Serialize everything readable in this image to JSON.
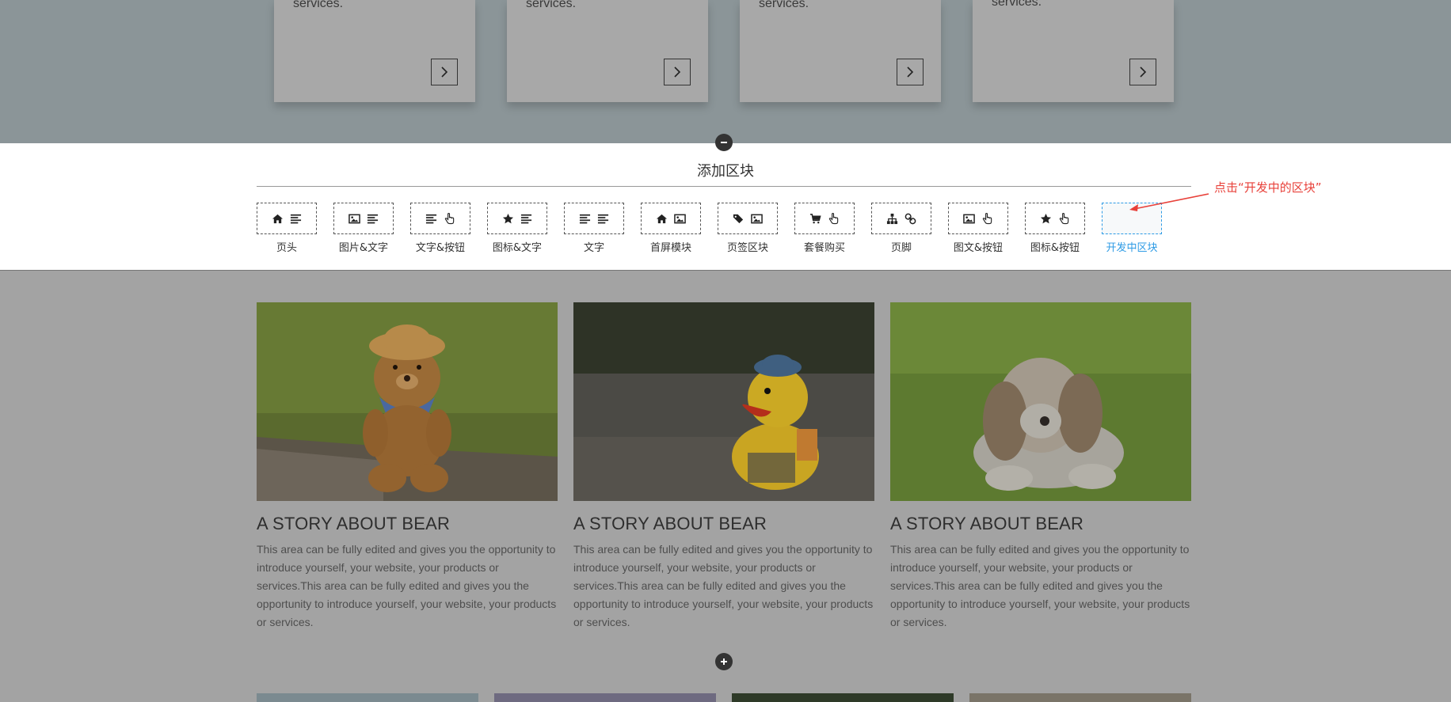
{
  "service_cards": [
    {
      "text": "services."
    },
    {
      "text": "services."
    },
    {
      "text": "services."
    },
    {
      "text": "services."
    }
  ],
  "icons": {
    "card_button": "chevron-right-icon",
    "collapse": "minus-circle-icon",
    "expand": "plus-circle-icon"
  },
  "add_panel": {
    "title": "添加区块",
    "blocks": [
      {
        "label": "页头",
        "icons": [
          "home-icon",
          "align-left-icon"
        ]
      },
      {
        "label": "图片&文字",
        "icons": [
          "image-icon",
          "align-left-icon"
        ]
      },
      {
        "label": "文字&按钮",
        "icons": [
          "align-left-icon",
          "hand-pointer-icon"
        ]
      },
      {
        "label": "图标&文字",
        "icons": [
          "star-icon",
          "align-left-icon"
        ]
      },
      {
        "label": "文字",
        "icons": [
          "align-left-icon",
          "align-left-icon"
        ]
      },
      {
        "label": "首屏模块",
        "icons": [
          "home-icon",
          "image-icon"
        ]
      },
      {
        "label": "页签区块",
        "icons": [
          "tags-icon",
          "image-icon"
        ]
      },
      {
        "label": "套餐购买",
        "icons": [
          "cart-icon",
          "hand-pointer-icon"
        ]
      },
      {
        "label": "页脚",
        "icons": [
          "sitemap-icon",
          "link-icon"
        ]
      },
      {
        "label": "图文&按钮",
        "icons": [
          "image-icon",
          "hand-pointer-icon"
        ]
      },
      {
        "label": "图标&按钮",
        "icons": [
          "star-icon",
          "hand-pointer-icon"
        ]
      },
      {
        "label": "开发中区块",
        "icons": []
      }
    ],
    "active_index": 11
  },
  "annotation": {
    "text": "点击“开发中的区块”"
  },
  "stories": [
    {
      "image": "teddy bear on tree stump",
      "title": "A STORY ABOUT BEAR",
      "body": "This area can be fully edited and gives you the opportunity to introduce yourself, your website, your products or services.This area can be fully edited and gives you the opportunity to introduce yourself, your website, your products or services."
    },
    {
      "image": "rubber duck with hat",
      "title": "A STORY ABOUT BEAR",
      "body": "This area can be fully edited and gives you the opportunity to introduce yourself, your website, your products or services.This area can be fully edited and gives you the opportunity to introduce yourself, your website, your products or services."
    },
    {
      "image": "plush puppy on grass",
      "title": "A STORY ABOUT BEAR",
      "body": "This area can be fully edited and gives you the opportunity to introduce yourself, your website, your products or services.This area can be fully edited and gives you the opportunity to introduce yourself, your website, your products or services."
    }
  ],
  "colors": {
    "accent": "#2e9be5",
    "annotation": "#e8413a",
    "overlay_bg": "#a3a3a3",
    "panel_bg": "#ffffff"
  }
}
